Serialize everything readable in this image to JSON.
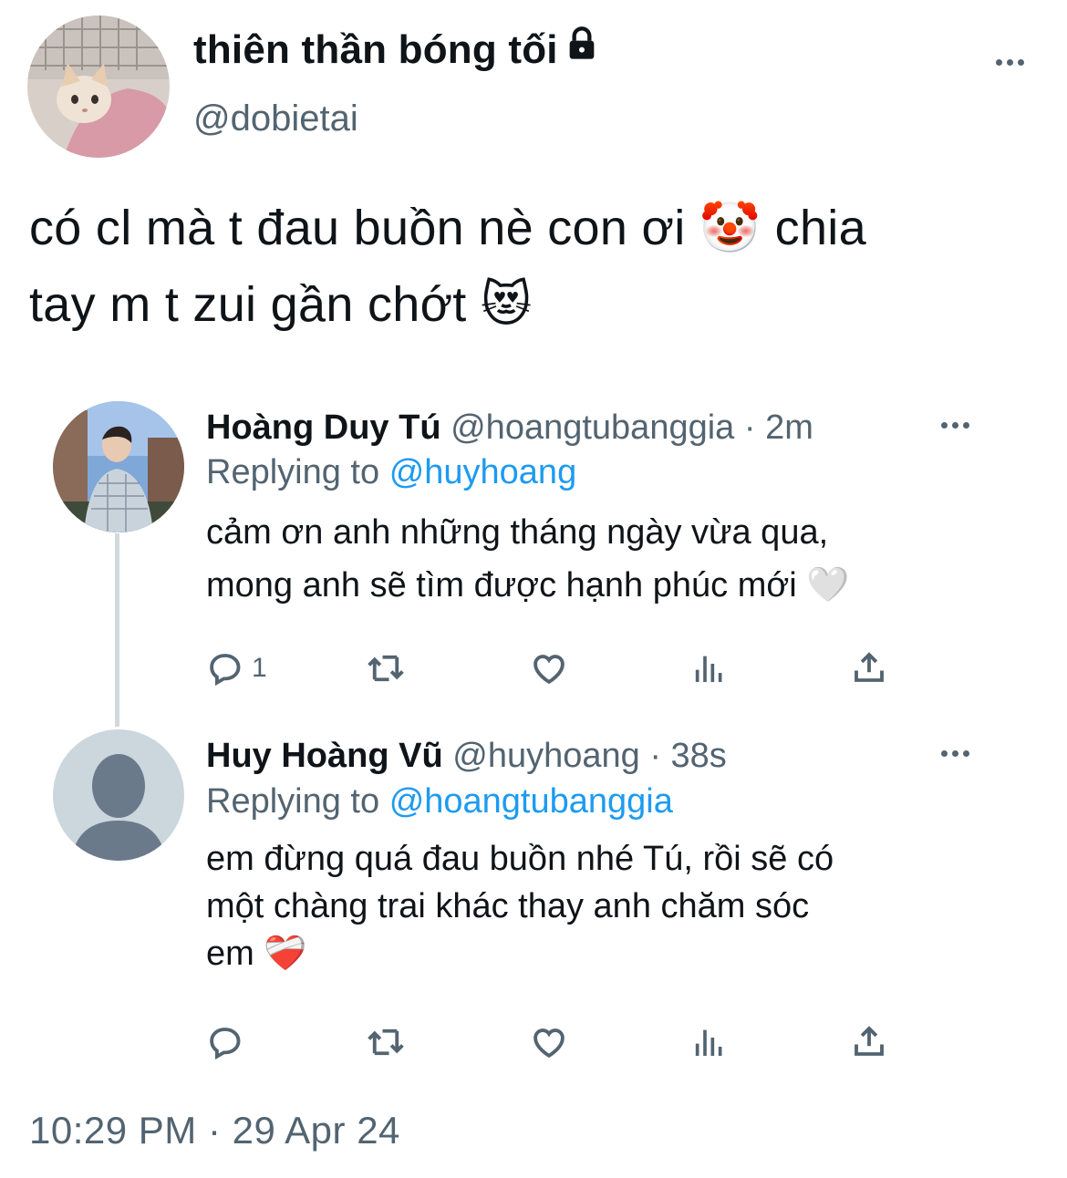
{
  "author": {
    "display_name": "thiên thần bóng tối",
    "handle": "@dobietai",
    "avatar": "cat-avatar"
  },
  "tweet": {
    "text_line1": "có cl mà t đau buồn nè con ơi 🤡 chia",
    "text_line2": "tay m t zui gần chớt 😻",
    "timestamp": "10:29 PM · 29 Apr 24"
  },
  "replies": [
    {
      "name": "Hoàng Duy Tú",
      "handle": "@hoangtubanggia",
      "time": "· 2m",
      "replying_prefix": "Replying to",
      "replying_to": "@huyhoang",
      "line1": "cảm ơn anh những tháng ngày vừa qua,",
      "line2": "mong anh sẽ tìm được hạnh phúc mới 🤍",
      "reply_count": "1"
    },
    {
      "name": "Huy Hoàng Vũ",
      "handle": "@huyhoang",
      "time": "· 38s",
      "replying_prefix": "Replying to",
      "replying_to": "@hoangtubanggia",
      "line1": "em đừng quá đau buồn nhé Tú, rồi sẽ có",
      "line2": "một chàng trai khác thay anh chăm sóc",
      "line3": "em ❤️‍🩹",
      "reply_count": ""
    }
  ],
  "colors": {
    "text": "#0f1419",
    "secondary": "#536471",
    "link": "#1d9bf0",
    "thread_line": "#cfd9de"
  },
  "icons": [
    "lock-icon",
    "more-icon",
    "reply-icon",
    "retweet-icon",
    "like-icon",
    "views-icon",
    "share-icon"
  ]
}
